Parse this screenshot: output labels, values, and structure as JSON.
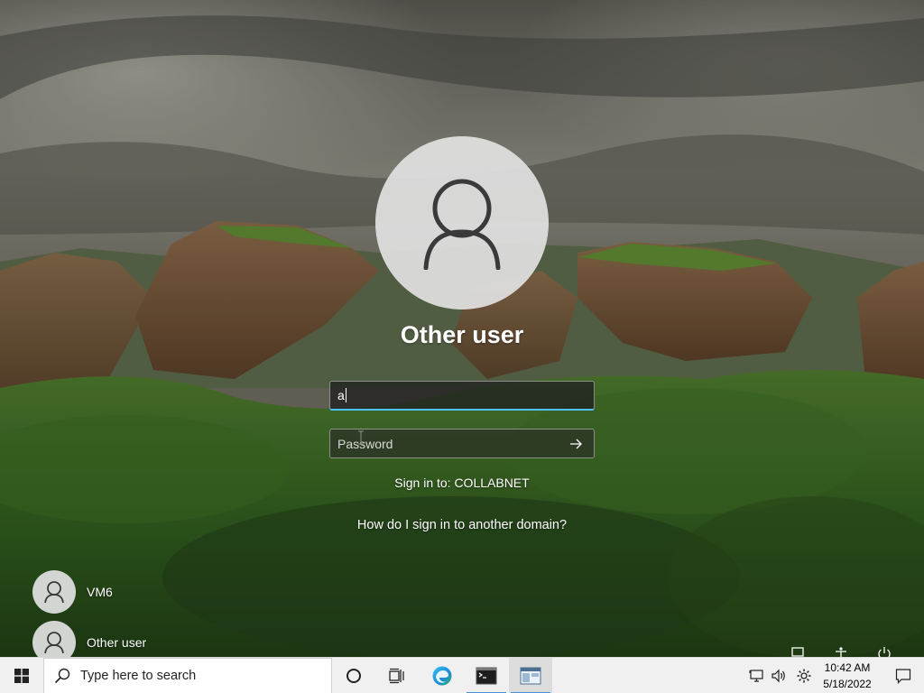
{
  "login": {
    "user_title": "Other user",
    "username_value": "a",
    "password_placeholder": "Password",
    "sign_in_to": "Sign in to: COLLABNET",
    "domain_help_link": "How do I sign in to another domain?"
  },
  "user_tiles": [
    {
      "name": "VM6"
    },
    {
      "name": "Other user"
    }
  ],
  "taskbar": {
    "search_placeholder": "Type here to search",
    "apps": [
      "cortana-icon",
      "task-view-icon",
      "edge-icon",
      "terminal-icon",
      "window-app-icon"
    ],
    "tray": [
      "network-icon",
      "volume-icon",
      "settings-icon"
    ],
    "time": "10:42 AM",
    "date": "5/18/2022"
  },
  "colors": {
    "accent": "#4cc2ff",
    "taskbar_bg": "#f0f0f0",
    "avatar_bg": "#e2e2e2"
  }
}
